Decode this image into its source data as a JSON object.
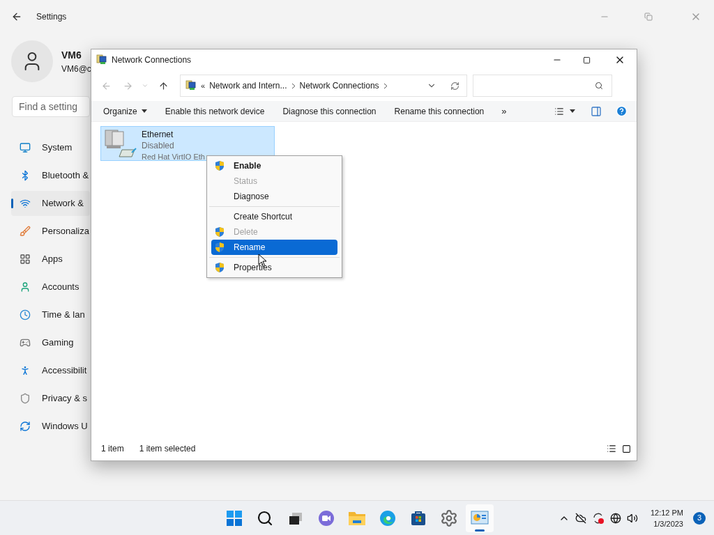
{
  "settings": {
    "title": "Settings",
    "user": {
      "name": "VM6",
      "email": "VM6@c"
    },
    "search": {
      "placeholder": "Find a setting"
    },
    "nav": [
      {
        "label": "System",
        "selected": false
      },
      {
        "label": "Bluetooth &",
        "selected": false
      },
      {
        "label": "Network &",
        "selected": true
      },
      {
        "label": "Personaliza",
        "selected": false
      },
      {
        "label": "Apps",
        "selected": false
      },
      {
        "label": "Accounts",
        "selected": false
      },
      {
        "label": "Time & lan",
        "selected": false
      },
      {
        "label": "Gaming",
        "selected": false
      },
      {
        "label": "Accessibilit",
        "selected": false
      },
      {
        "label": "Privacy & s",
        "selected": false
      },
      {
        "label": "Windows U",
        "selected": false
      }
    ]
  },
  "explorer": {
    "title": "Network Connections",
    "address": {
      "prefix": "«",
      "crumbs": [
        "Network and Intern...",
        "Network Connections"
      ]
    },
    "commands": [
      {
        "label": "Organize",
        "dropdown": true
      },
      {
        "label": "Enable this network device",
        "dropdown": false
      },
      {
        "label": "Diagnose this connection",
        "dropdown": false
      },
      {
        "label": "Rename this connection",
        "dropdown": false
      }
    ],
    "overflow": "»",
    "items": [
      {
        "name": "Ethernet",
        "status": "Disabled",
        "device": "Red Hat VirtIO Eth",
        "selected": true
      }
    ],
    "status": [
      "1 item",
      "1 item selected"
    ]
  },
  "context_menu": {
    "items": [
      {
        "kind": "item",
        "label": "Enable",
        "shield": true,
        "default": true,
        "disabled": false,
        "selected": false
      },
      {
        "kind": "item",
        "label": "Status",
        "shield": false,
        "default": false,
        "disabled": true,
        "selected": false
      },
      {
        "kind": "item",
        "label": "Diagnose",
        "shield": false,
        "default": false,
        "disabled": false,
        "selected": false
      },
      {
        "kind": "separator"
      },
      {
        "kind": "item",
        "label": "Create Shortcut",
        "shield": false,
        "default": false,
        "disabled": false,
        "selected": false
      },
      {
        "kind": "item",
        "label": "Delete",
        "shield": true,
        "default": false,
        "disabled": true,
        "selected": false
      },
      {
        "kind": "item",
        "label": "Rename",
        "shield": true,
        "default": false,
        "disabled": false,
        "selected": true
      },
      {
        "kind": "separator"
      },
      {
        "kind": "item",
        "label": "Properties",
        "shield": true,
        "default": false,
        "disabled": false,
        "selected": false
      }
    ]
  },
  "taskbar": {
    "apps": [
      {
        "active": false
      },
      {
        "active": false
      },
      {
        "active": false
      },
      {
        "active": false
      },
      {
        "active": false
      },
      {
        "active": false
      },
      {
        "active": false
      },
      {
        "active": false
      },
      {
        "active": true
      }
    ],
    "clock": {
      "time": "12:12 PM",
      "date": "1/3/2023"
    },
    "notifications": "3"
  }
}
